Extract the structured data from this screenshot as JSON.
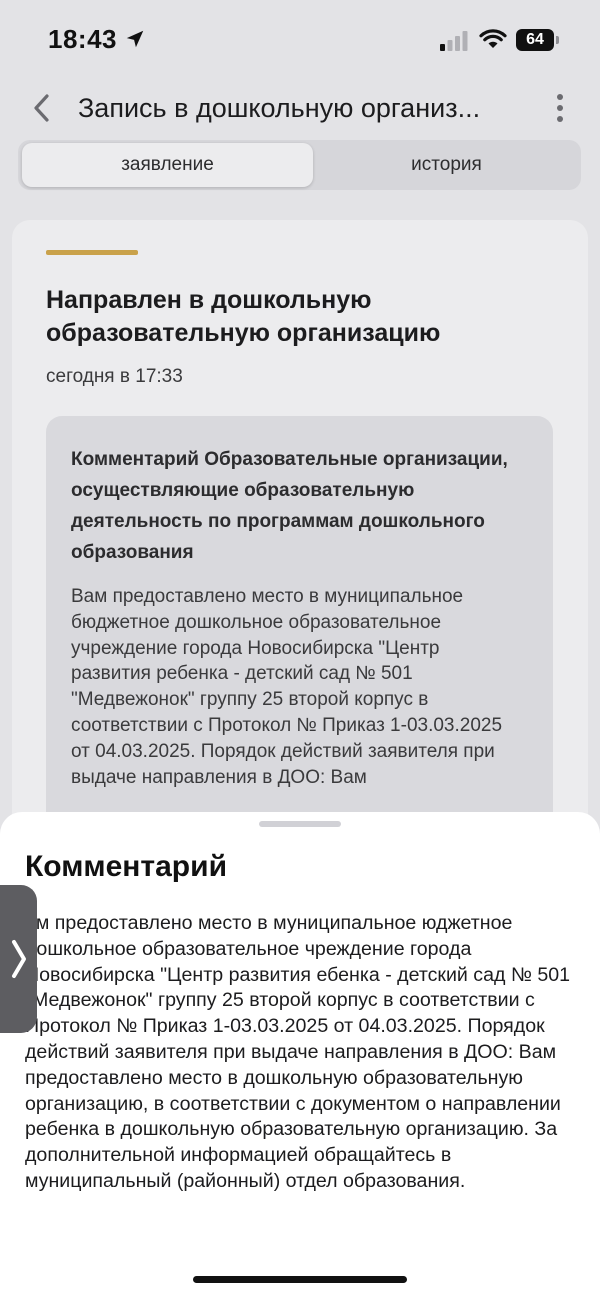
{
  "status_bar": {
    "time": "18:43",
    "battery": "64",
    "icons": [
      "location-arrow-icon",
      "signal-icon",
      "wifi-icon",
      "battery-icon"
    ]
  },
  "header": {
    "title": "Запись в дошкольную организ...",
    "icons": [
      "chevron-left-icon",
      "more-vertical-icon"
    ]
  },
  "tabs": [
    {
      "label": "заявление",
      "active": true
    },
    {
      "label": "история",
      "active": false
    }
  ],
  "card": {
    "accent_color": "#c9a14a",
    "title": "Направлен в дошкольную образовательную организацию",
    "time": "сегодня в 17:33",
    "comment_heading": "Комментарий Образовательные организации, осуществляющие образовательную деятельность по программам дошкольного образования",
    "comment_text": "Вам предоставлено место в муниципальное бюджетное дошкольное образовательное учреждение города Новосибирска \"Центр развития ребенка - детский сад № 501 \"Медвежонок\" группу 25 второй корпус в соответствии с Протокол № Приказ 1-03.03.2025 от 04.03.2025. Порядок действий заявителя при выдаче направления в ДОО: Вам"
  },
  "sheet": {
    "title": "Комментарий",
    "text": "ам предоставлено место в муниципальное юджетное дошкольное образовательное чреждение города Новосибирска \"Центр развития ебенка - детский сад № 501 \"Медвежонок\" группу 25 второй корпус в соответствии с Протокол № Приказ 1-03.03.2025 от 04.03.2025. Порядок действий заявителя при выдаче направления в ДОО: Вам предоставлено место в дошкольную образовательную организацию, в соответствии с документом о направлении ребенка в дошкольную образовательную организацию. За дополнительной информацией обращайтесь в муниципальный (районный) отдел образования."
  },
  "side_handle": {
    "icon": "chevron-right-icon"
  }
}
